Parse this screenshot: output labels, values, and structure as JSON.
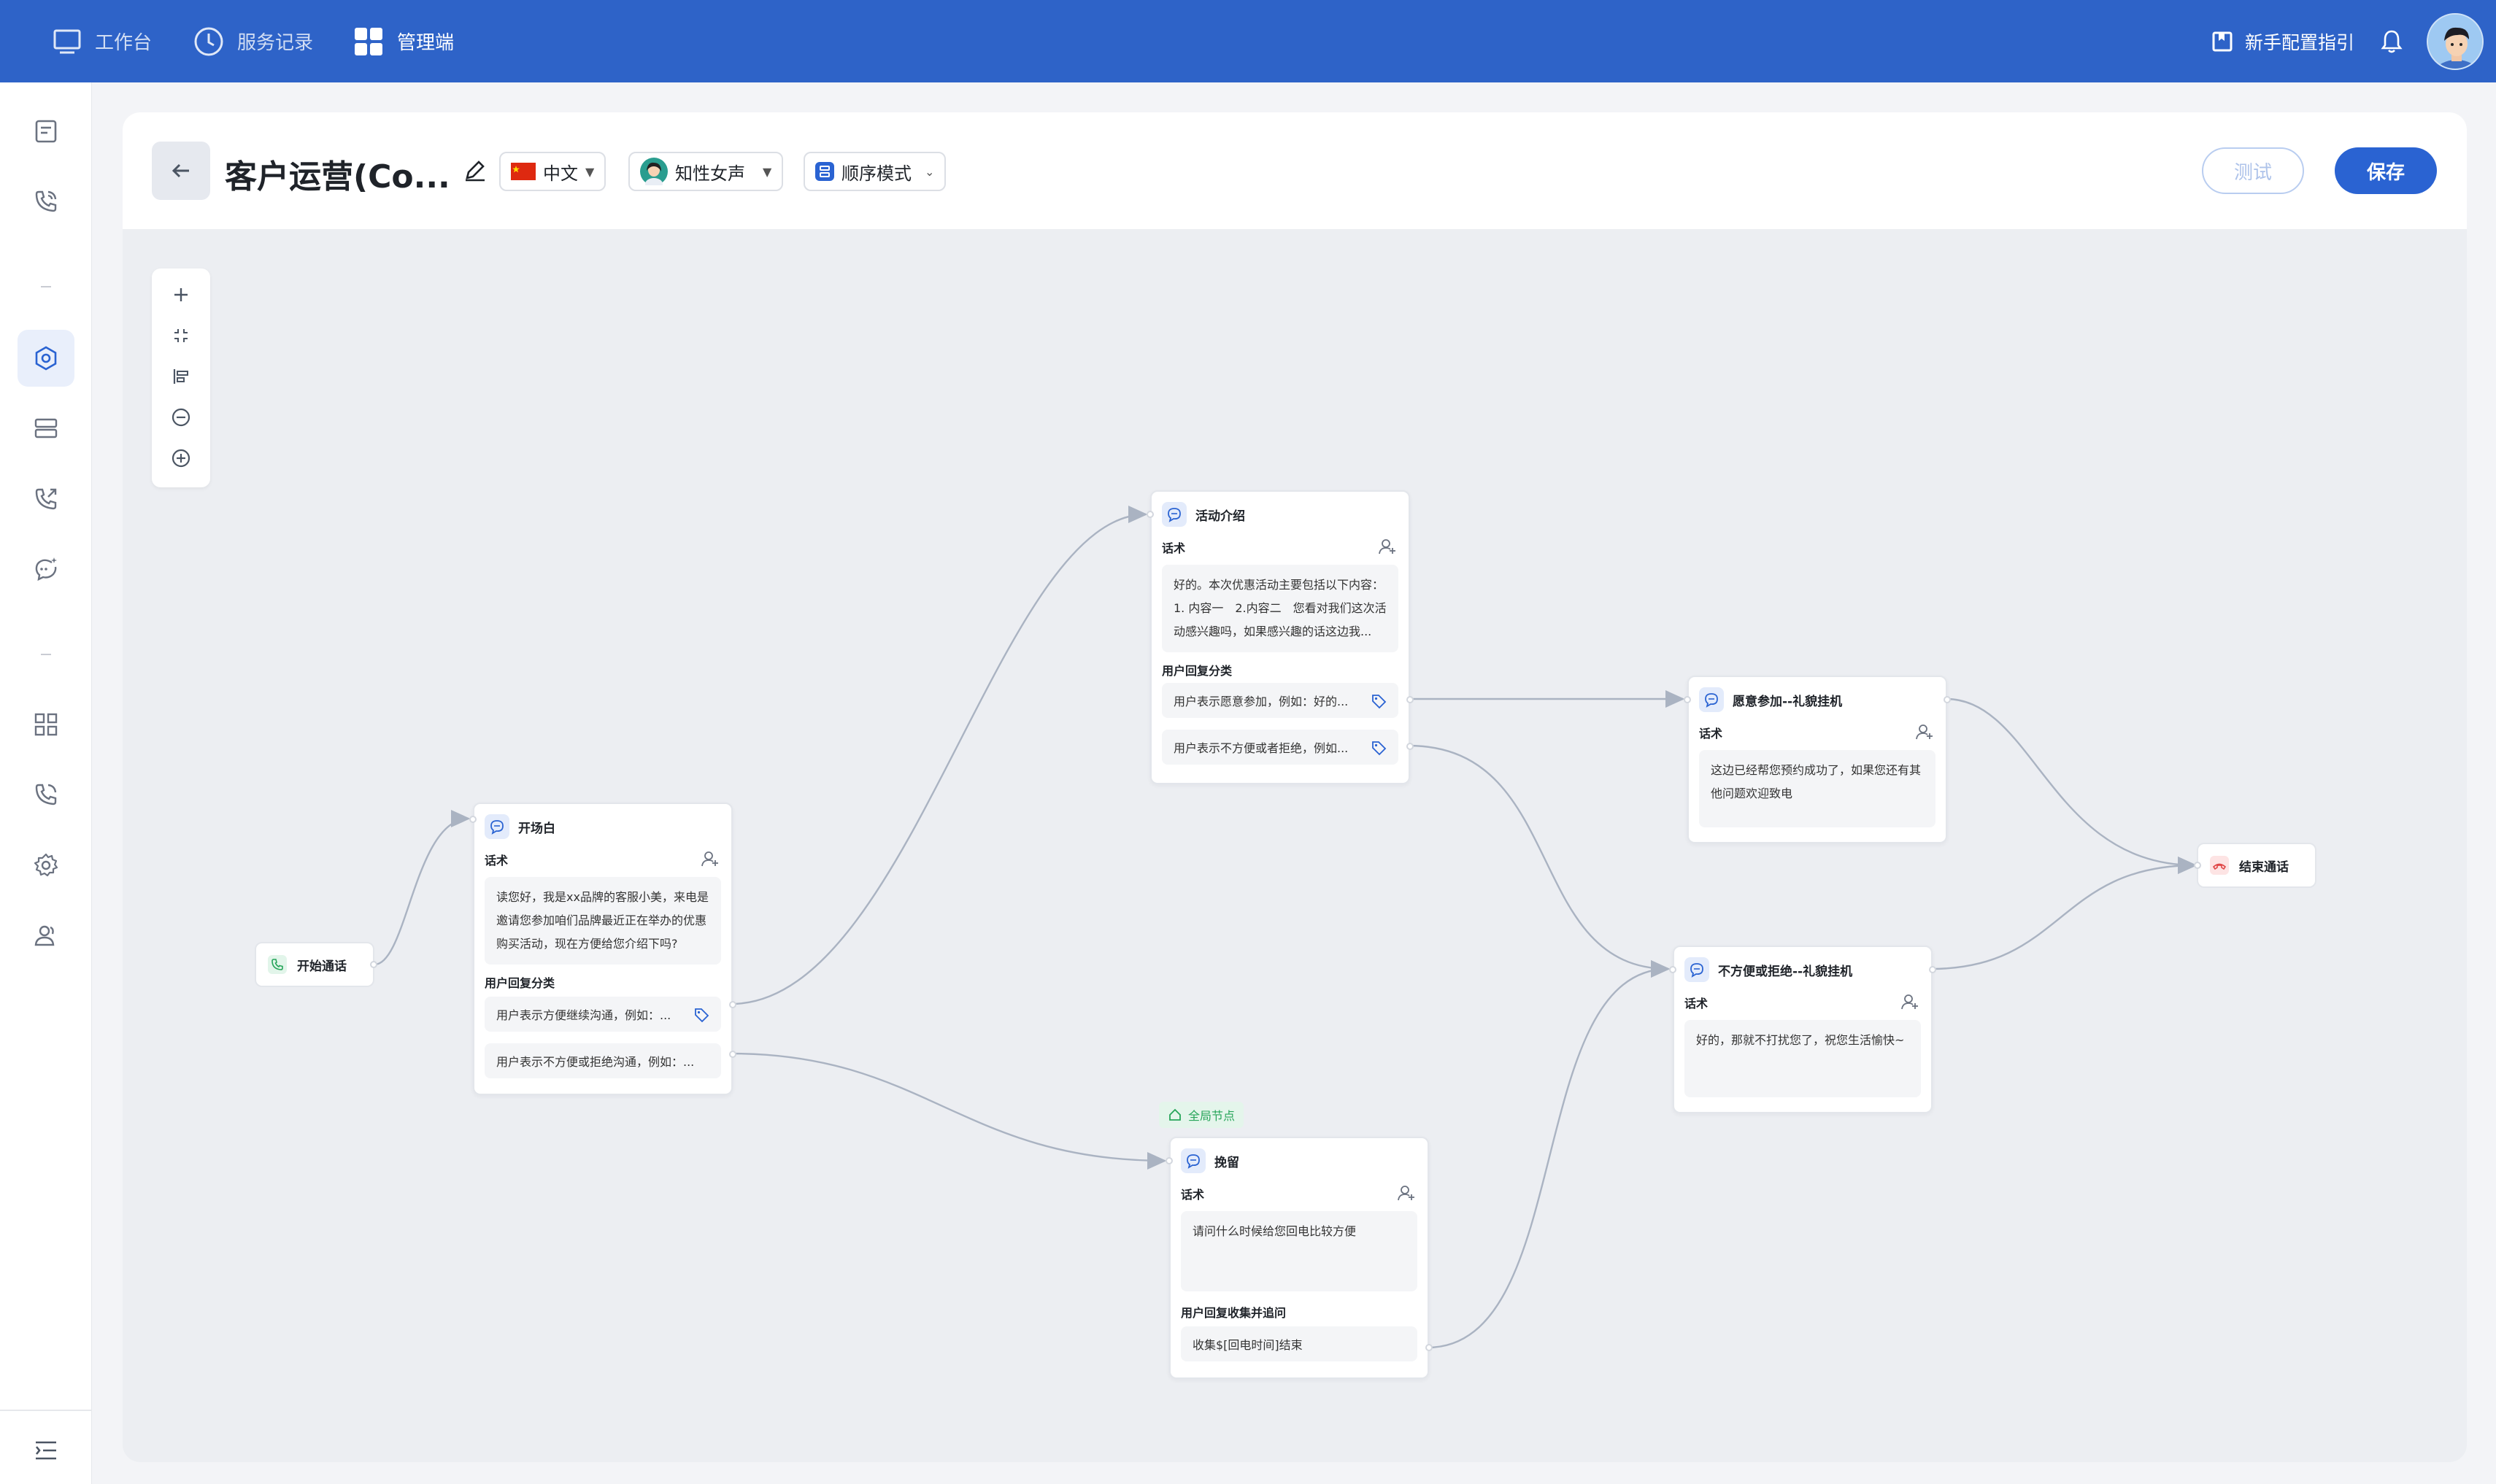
{
  "topbar": {
    "nav": [
      {
        "label": "工作台",
        "icon": "monitor-icon"
      },
      {
        "label": "服务记录",
        "icon": "clock-icon"
      },
      {
        "label": "管理端",
        "icon": "grid-icon"
      }
    ],
    "guide_label": "新手配置指引",
    "bg_color": "#2e63c8"
  },
  "sidebar": {
    "items": [
      {
        "icon": "document-icon"
      },
      {
        "icon": "phone-call-icon"
      },
      {
        "icon": "hexagon-settings-icon",
        "active": true
      },
      {
        "icon": "server-list-icon"
      },
      {
        "icon": "phone-outgoing-icon"
      },
      {
        "icon": "chat-sparkle-icon"
      },
      {
        "icon": "apps-grid-icon"
      },
      {
        "icon": "phone-ring-icon"
      },
      {
        "icon": "gear-icon"
      },
      {
        "icon": "users-icon"
      }
    ],
    "footer_icon": "collapse-menu-icon"
  },
  "header": {
    "title": "客户运营(Co...",
    "language": "中文",
    "voice": "知性女声",
    "mode": "顺序模式",
    "test_label": "测试",
    "save_label": "保存",
    "accent": "#2a63d2"
  },
  "flow": {
    "start": {
      "label": "开始通话"
    },
    "end": {
      "label": "结束通话"
    },
    "opening": {
      "title": "开场白",
      "speech_label": "话术",
      "speech": [
        "读您好，我是xx品牌的客服小美，来电是",
        "邀请您参加咱们品牌最近正在举办的优惠",
        "购买活动，现在方便给您介绍下吗?"
      ],
      "reply_label": "用户回复分类",
      "replies": [
        "用户表示方便继续沟通，例如：...",
        "用户表示不方便或拒绝沟通，例如：..."
      ]
    },
    "activity": {
      "title": "活动介绍",
      "speech_label": "话术",
      "speech": [
        "好的。本次优惠活动主要包括以下内容：",
        "1. 内容一　2.内容二　您看对我们这次活",
        "动感兴趣吗，如果感兴趣的话这边我..."
      ],
      "reply_label": "用户回复分类",
      "replies": [
        "用户表示愿意参加，例如：好的...",
        "用户表示不方便或者拒绝，例如..."
      ]
    },
    "willing": {
      "title": "愿意参加--礼貌挂机",
      "speech_label": "话术",
      "speech": [
        "这边已经帮您预约成功了，如果您还有其",
        "他问题欢迎致电"
      ]
    },
    "decline": {
      "title": "不方便或拒绝--礼貌挂机",
      "speech_label": "话术",
      "speech": [
        "好的，那就不打扰您了，祝您生活愉快~"
      ]
    },
    "retain": {
      "global_tag": "全局节点",
      "title": "挽留",
      "speech_label": "话术",
      "speech": [
        "请问什么时候给您回电比较方便"
      ],
      "collect_label": "用户回复收集并追问",
      "collect": "收集$[回电时间]结束"
    }
  }
}
